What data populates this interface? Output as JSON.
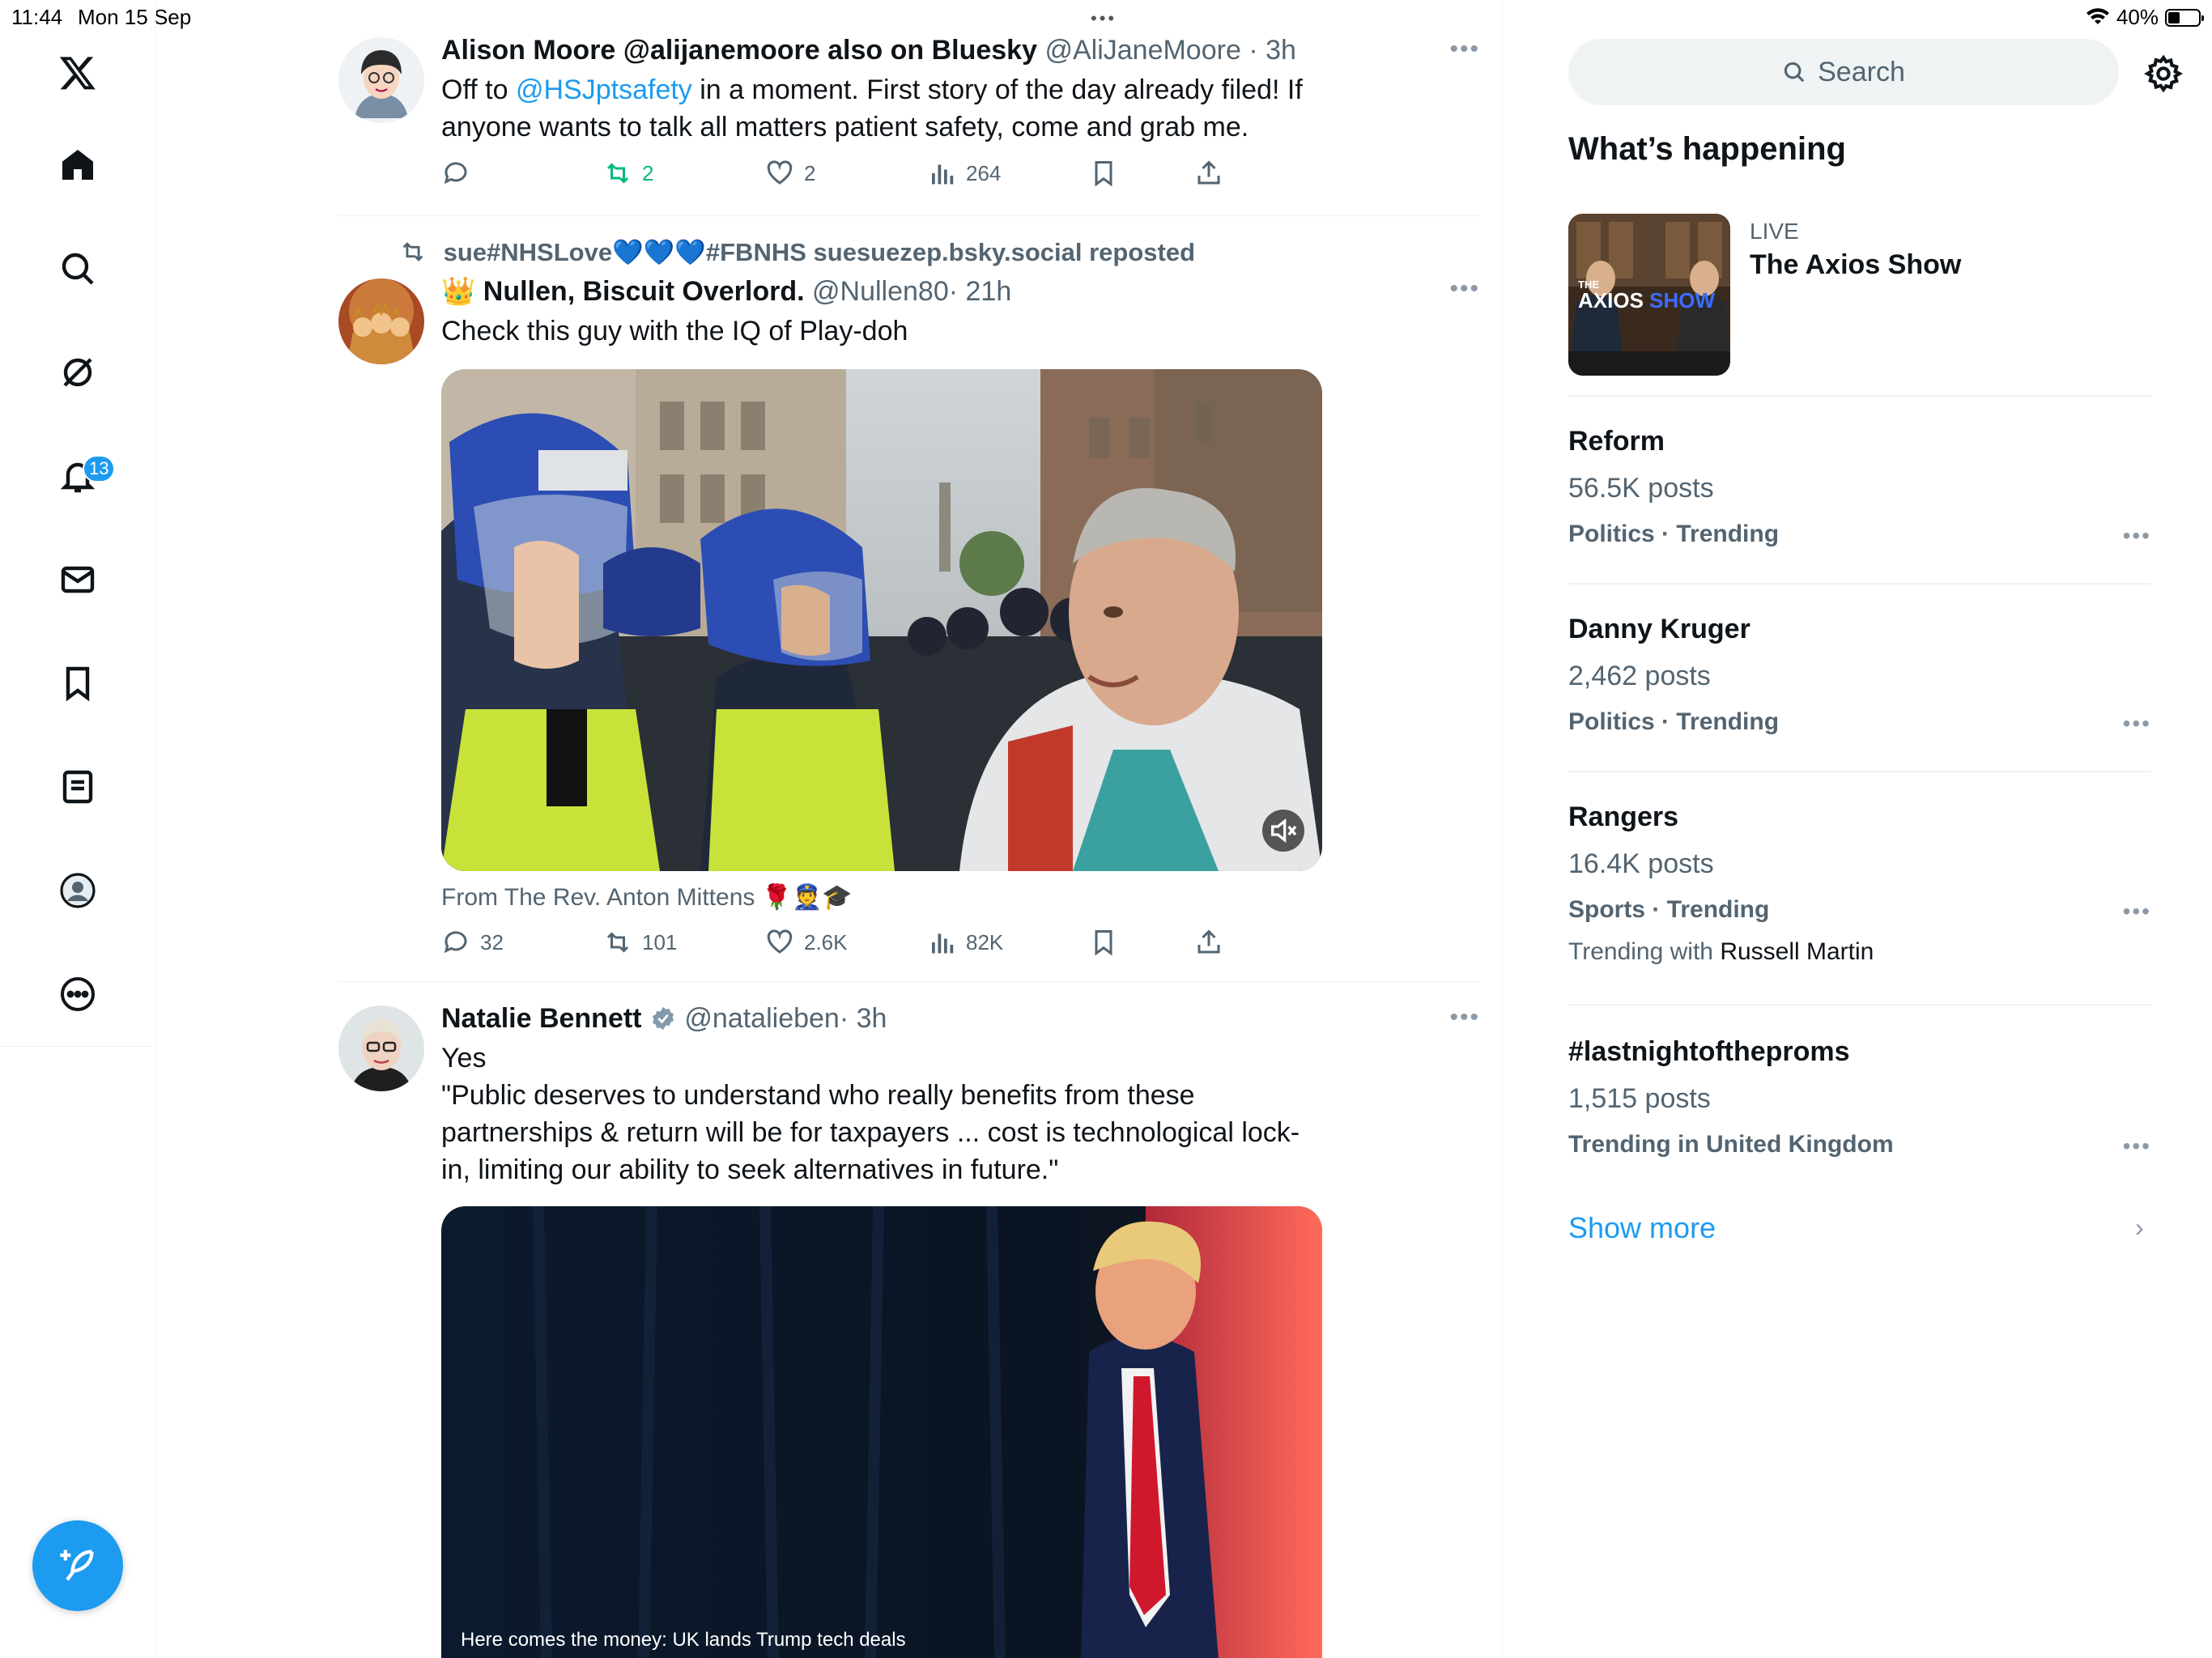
{
  "status_bar": {
    "time": "11:44",
    "date": "Mon 15 Sep",
    "battery": "40%",
    "battery_level": 0.4
  },
  "nav": {
    "items": [
      "x-logo",
      "home",
      "search",
      "grok",
      "notifications",
      "messages",
      "bookmarks",
      "lists",
      "profile",
      "more"
    ],
    "notifications_badge": "13"
  },
  "tweets": [
    {
      "name": "Alison Moore @alijanemoore also on Bluesky",
      "handle": "@AliJaneMoore",
      "time": "· 3h",
      "text_before": "Off to ",
      "mention": "@HSJptsafety",
      "text_after": "  in a moment. First story of the day already filed! If anyone wants to talk all matters patient safety, come and grab me.",
      "replies": "",
      "reposts": "2",
      "likes": "2",
      "views": "264"
    },
    {
      "repost_line": "sue#NHSLove💙💙💙#FBNHS suesuezep.bsky.social reposted",
      "name_emoji": "👑",
      "name": "Nullen, Biscuit Overlord.",
      "handle": "@Nullen80",
      "time": "· 21h",
      "text": "Check this guy with the IQ of Play-doh",
      "from_line": "From The Rev. Anton Mittens 🌹👮🎓",
      "replies": "32",
      "reposts": "101",
      "likes": "2.6K",
      "views": "82K"
    },
    {
      "name": "Natalie Bennett",
      "handle": "@natalieben",
      "time": "· 3h",
      "text": "Yes\n\"Public deserves to understand who really benefits from these partnerships & return will be for taxpayers ... cost is technological lock-in, limiting our ability to seek alternatives in future.\"",
      "media_caption": "Here comes the money: UK lands Trump tech deals"
    }
  ],
  "right": {
    "search_placeholder": "Search",
    "whats_happening": "What’s happening",
    "live": {
      "label": "LIVE",
      "title": "The Axios Show",
      "thumb_text_a": "THE",
      "thumb_text_b": "AXIOS",
      "thumb_text_c": "SHOW"
    },
    "trends": [
      {
        "name": "Reform",
        "count": "56.5K posts",
        "category": "Politics · Trending",
        "with_label": "",
        "with_name": ""
      },
      {
        "name": "Danny Kruger",
        "count": "2,462 posts",
        "category": "Politics · Trending",
        "with_label": "",
        "with_name": ""
      },
      {
        "name": "Rangers",
        "count": "16.4K posts",
        "category": "Sports · Trending",
        "with_label": "Trending with ",
        "with_name": "Russell Martin"
      },
      {
        "name": "#lastnightoftheproms",
        "count": "1,515 posts",
        "category": "Trending in United Kingdom",
        "with_label": "",
        "with_name": ""
      }
    ],
    "show_more": "Show more"
  },
  "colors": {
    "accent": "#1d9bf0",
    "repost_green": "#00ba7c",
    "muted": "#536471"
  }
}
